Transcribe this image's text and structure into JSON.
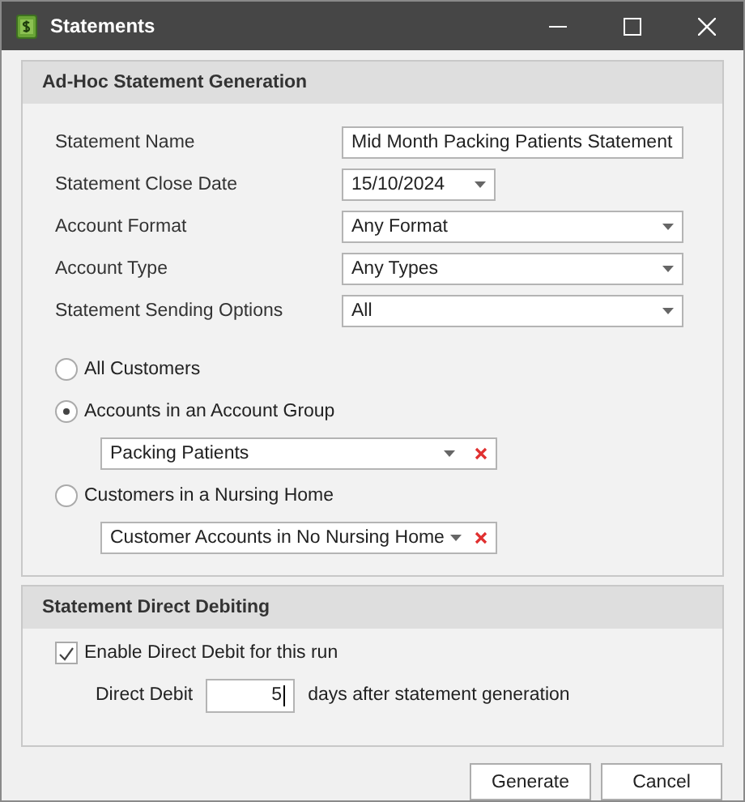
{
  "window": {
    "title": "Statements"
  },
  "generation": {
    "title": "Ad-Hoc Statement Generation",
    "fields": [
      {
        "label": "Statement Name",
        "kind": "text",
        "value": "Mid Month Packing Patients Statement"
      },
      {
        "label": "Statement Close Date",
        "kind": "date",
        "value": "15/10/2024"
      },
      {
        "label": "Account Format",
        "kind": "select",
        "value": "Any Format"
      },
      {
        "label": "Account Type",
        "kind": "select",
        "value": "Any Types"
      },
      {
        "label": "Statement Sending Options",
        "kind": "select",
        "value": "All"
      }
    ],
    "scope": [
      {
        "label": "All Customers",
        "selected": false
      },
      {
        "label": "Accounts in an Account Group",
        "selected": true,
        "combo": "Packing Patients"
      },
      {
        "label": "Customers in a Nursing Home",
        "selected": false,
        "combo": "Customer Accounts in No Nursing Home"
      }
    ]
  },
  "debiting": {
    "title": "Statement Direct Debiting",
    "enable": {
      "label": "Enable Direct Debit for this run",
      "checked": true
    },
    "days": {
      "label": "Direct Debit",
      "value": "5",
      "suffix": "days after statement generation"
    }
  },
  "buttons": [
    "Generate",
    "Cancel"
  ]
}
